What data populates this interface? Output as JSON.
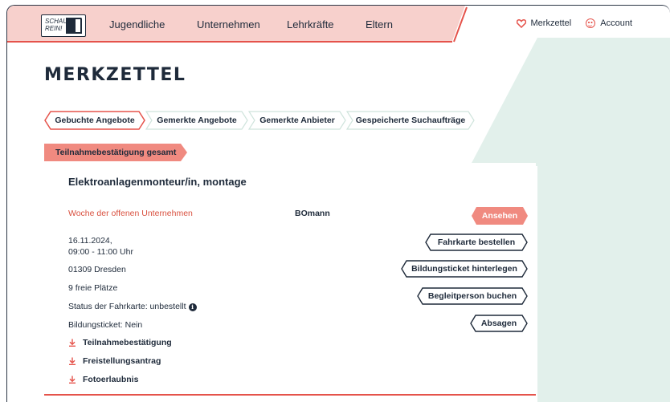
{
  "header": {
    "logo_text": "SCHAU REIN!",
    "nav": [
      "Jugendliche",
      "Unternehmen",
      "Lehrkräfte",
      "Eltern"
    ],
    "merkzettel": "Merkzettel",
    "account": "Account"
  },
  "page_title": "MERKZETTEL",
  "tabs": [
    {
      "label": "Gebuchte Angebote",
      "active": true
    },
    {
      "label": "Gemerkte Angebote",
      "active": false
    },
    {
      "label": "Gemerkte Anbieter",
      "active": false
    },
    {
      "label": "Gespeicherte Suchaufträge",
      "active": false
    }
  ],
  "badge_label": "Teilnahmebestätigung gesamt",
  "offer": {
    "title": "Elektroanlagenmonteur/in, montage",
    "event": "Woche der offenen Unternehmen",
    "organizer": "BOmann",
    "date": "16.11.2024,",
    "time": "09:00 - 11:00 Uhr",
    "location": "01309 Dresden",
    "spots": "9 freie Plätze",
    "ticket_status": "Status der Fahrkarte: unbestellt",
    "education_ticket": "Bildungsticket: Nein",
    "downloads": [
      "Teilnahmebestätigung",
      "Freistellungsantrag",
      "Fotoerlaubnis"
    ]
  },
  "buttons": {
    "view": "Ansehen",
    "order_ticket": "Fahrkarte bestellen",
    "deposit_ticket": "Bildungsticket hinterlegen",
    "book_companion": "Begleitperson buchen",
    "cancel": "Absagen"
  },
  "colors": {
    "accent": "#e5534b",
    "accent_light": "#f5b8b2",
    "header_pink": "#f7d0cc",
    "mint": "#e2f0eb",
    "navy": "#1e2a3a"
  }
}
